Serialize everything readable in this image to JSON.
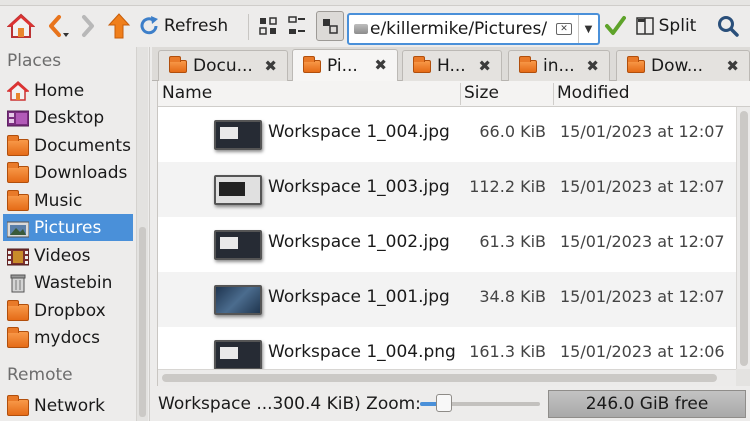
{
  "toolbar": {
    "refresh_label": "Refresh",
    "path_value": "e/killermike/Pictures/",
    "split_label": "Split"
  },
  "sidebar": {
    "places_heading": "Places",
    "places": [
      {
        "label": "Home",
        "icon": "home-icon"
      },
      {
        "label": "Desktop",
        "icon": "desktop-icon"
      },
      {
        "label": "Documents",
        "icon": "documents-folder-icon"
      },
      {
        "label": "Downloads",
        "icon": "downloads-folder-icon"
      },
      {
        "label": "Music",
        "icon": "music-folder-icon"
      },
      {
        "label": "Pictures",
        "icon": "pictures-folder-icon",
        "selected": true
      },
      {
        "label": "Videos",
        "icon": "videos-folder-icon"
      },
      {
        "label": "Wastebin",
        "icon": "trash-icon"
      },
      {
        "label": "Dropbox",
        "icon": "folder-icon"
      },
      {
        "label": "mydocs",
        "icon": "folder-icon"
      }
    ],
    "remote_heading": "Remote",
    "remote": [
      {
        "label": "Network",
        "icon": "network-folder-icon"
      }
    ]
  },
  "tabs": [
    {
      "label": "Docu...",
      "active": false
    },
    {
      "label": "Pi...",
      "active": true
    },
    {
      "label": "H...",
      "active": false
    },
    {
      "label": "in...",
      "active": false
    },
    {
      "label": "Dow...",
      "active": false
    }
  ],
  "columns": {
    "name": "Name",
    "size": "Size",
    "modified": "Modified"
  },
  "files": [
    {
      "name": "Workspace 1_004.jpg",
      "size": "66.0 KiB",
      "modified": "15/01/2023 at 12:07",
      "thumb": "dark"
    },
    {
      "name": "Workspace 1_003.jpg",
      "size": "112.2 KiB",
      "modified": "15/01/2023 at 12:07",
      "thumb": "light"
    },
    {
      "name": "Workspace 1_002.jpg",
      "size": "61.3 KiB",
      "modified": "15/01/2023 at 12:07",
      "thumb": "dark"
    },
    {
      "name": "Workspace 1_001.jpg",
      "size": "34.8 KiB",
      "modified": "15/01/2023 at 12:07",
      "thumb": "blue"
    },
    {
      "name": "Workspace 1_004.png",
      "size": "161.3 KiB",
      "modified": "15/01/2023 at 12:06",
      "thumb": "dark"
    }
  ],
  "status": {
    "selection_text": "Workspace ...300.4 KiB) Zoom:",
    "zoom_level": 0.2,
    "free_space": "246.0 GiB free"
  },
  "colors": {
    "accent": "#4a90d9",
    "folder": "#e56b17",
    "up_arrow": "#f07f1b",
    "go_check": "#5ea32a"
  }
}
